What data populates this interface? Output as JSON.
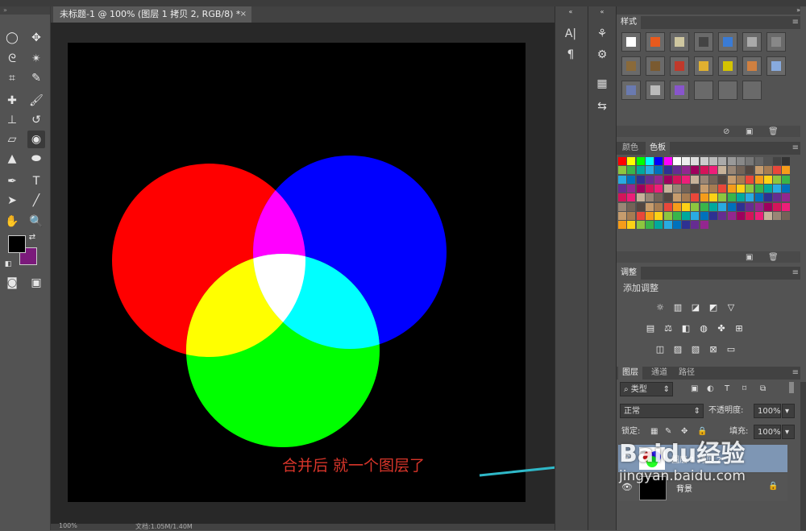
{
  "document": {
    "tab_title": "未标题-1 @ 100% (图层 1 拷贝 2, RGB/8) *",
    "tab_close": "×",
    "status_zoom": "100%",
    "status_doc": "文档:1.05M/1.40M"
  },
  "toolbar": {
    "foreground_color": "#000000",
    "background_color": "#7b1a7b"
  },
  "circles": [
    {
      "name": "red",
      "color": "#ff0000"
    },
    {
      "name": "blue",
      "color": "#0000ff"
    },
    {
      "name": "green",
      "color": "#00ff00"
    }
  ],
  "overlaps": {
    "magenta": "#ff00ff",
    "yellow": "#ffff00",
    "cyan": "#00ffff",
    "white": "#ffffff"
  },
  "annotation": {
    "text": "合并后 就一个图层了",
    "arrow_color": "#2fb8c8"
  },
  "panels": {
    "styles": {
      "title": "样式"
    },
    "color": {
      "tab_color": "颜色",
      "tab_swatches": "色板"
    },
    "adjustments": {
      "title": "调整",
      "subtitle": "添加调整"
    },
    "layers": {
      "tab_layers": "图层",
      "tab_channels": "通道",
      "tab_paths": "路径",
      "filter_kind": "类型",
      "blend_mode": "正常",
      "opacity_label": "不透明度:",
      "opacity_value": "100%",
      "lock_label": "锁定:",
      "fill_label": "填充:",
      "fill_value": "100%",
      "items": [
        {
          "name": "图层 1 拷贝 2",
          "selected": true
        },
        {
          "name": "背景",
          "selected": false
        }
      ]
    }
  },
  "watermark": {
    "brand": "Baidu经验",
    "url": "jingyan.baidu.com"
  }
}
